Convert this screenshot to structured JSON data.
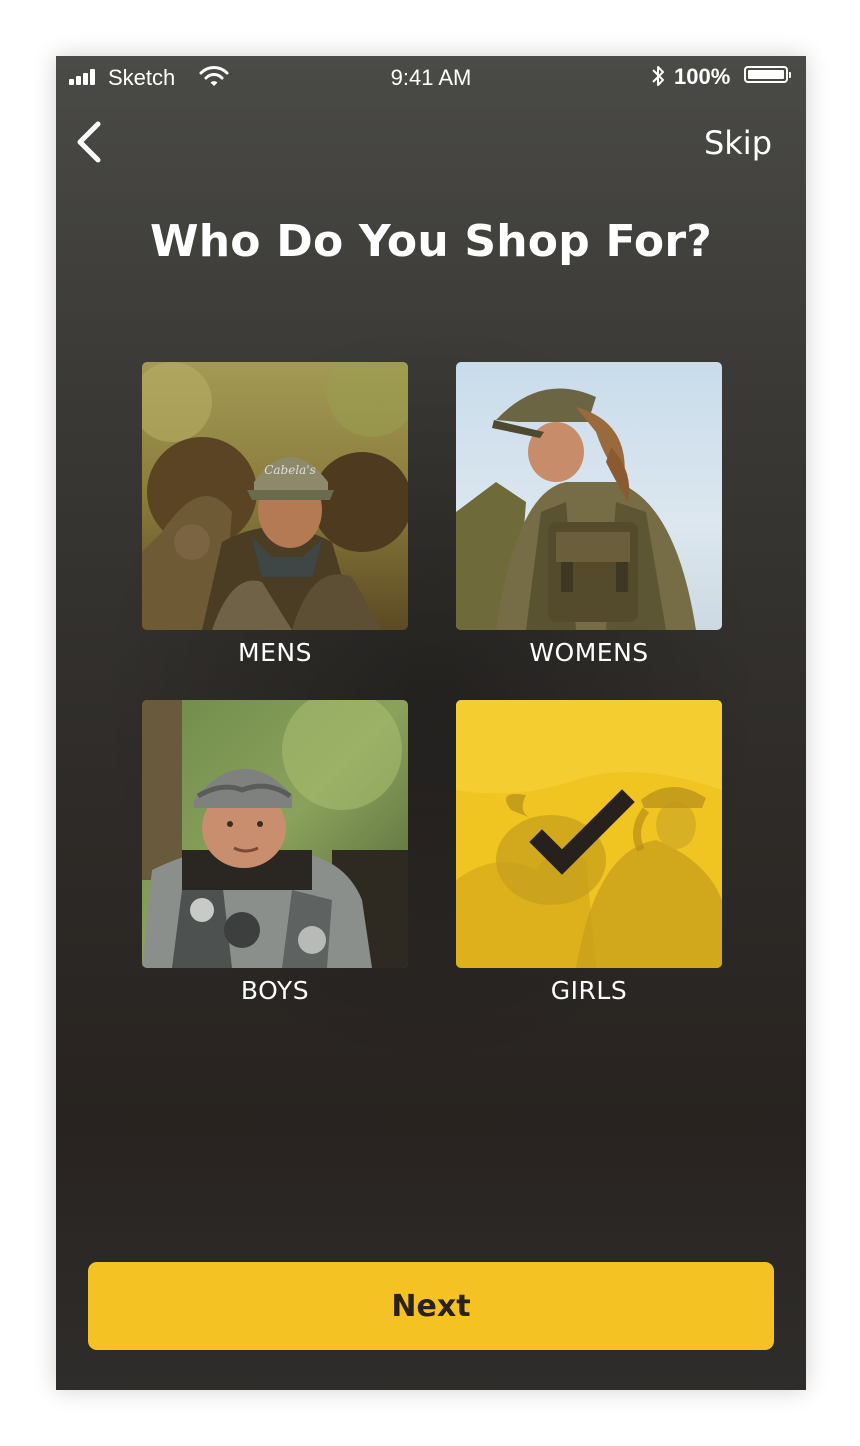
{
  "status_bar": {
    "carrier": "Sketch",
    "time": "9:41 AM",
    "battery_percent": "100%",
    "battery_level": 1.0
  },
  "header": {
    "back_icon": "chevron-left-icon",
    "skip_label": "Skip"
  },
  "title": "Who Do You Shop For?",
  "options": [
    {
      "label": "MENS",
      "selected": false
    },
    {
      "label": "WOMENS",
      "selected": false
    },
    {
      "label": "BOYS",
      "selected": false
    },
    {
      "label": "GIRLS",
      "selected": true
    }
  ],
  "next_label": "Next",
  "colors": {
    "accent": "#F4C323",
    "selected_overlay": "#EFC21E",
    "text": "#FFFFFF",
    "button_text": "#2A2118"
  }
}
